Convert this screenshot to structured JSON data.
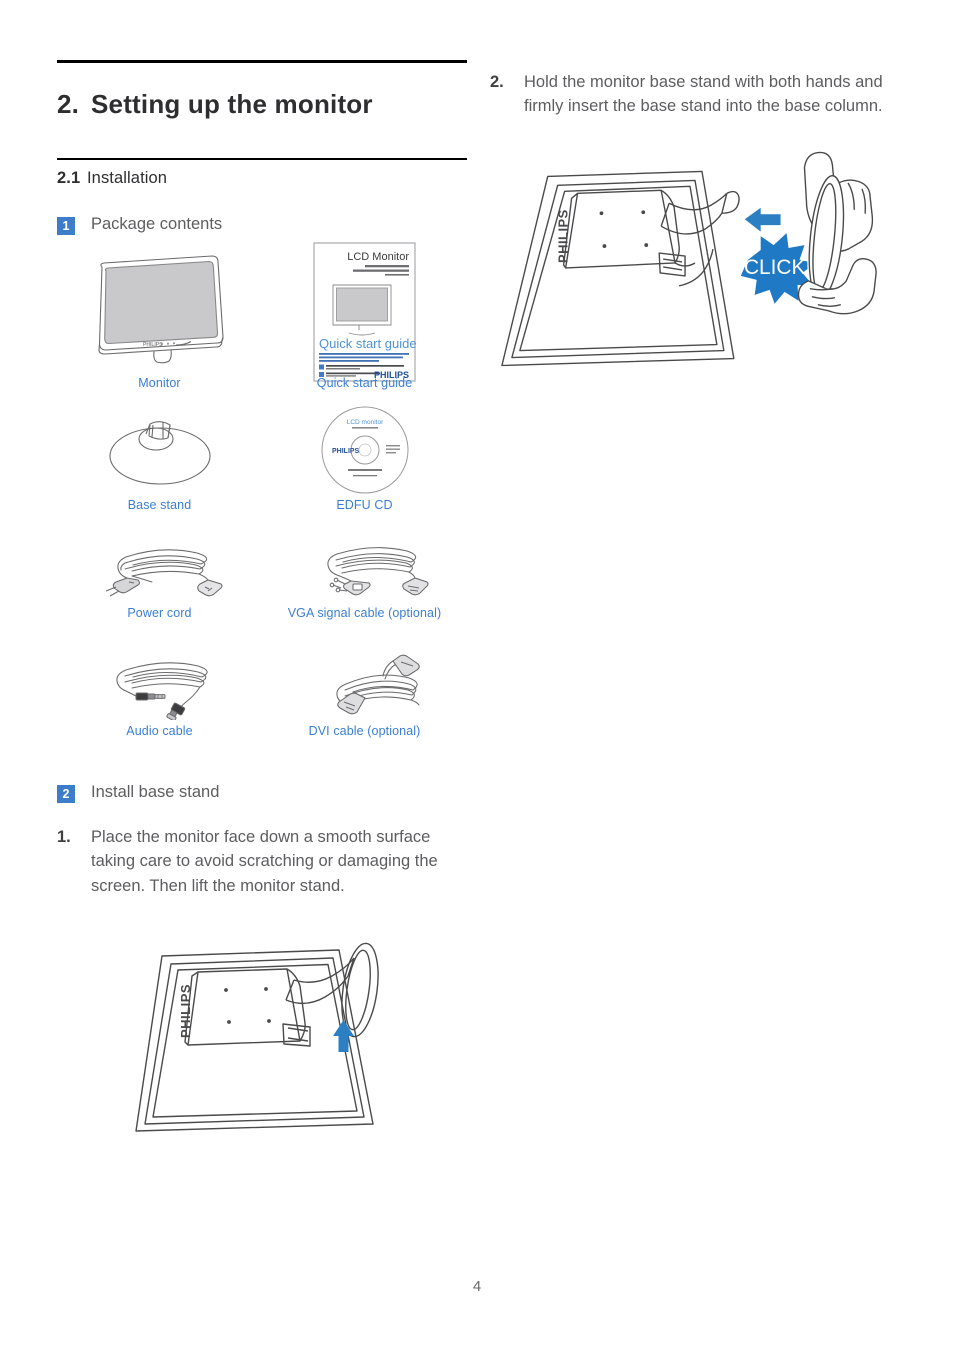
{
  "document": {
    "page_number": "4",
    "accent_blue": "#3b7fd4",
    "badge_blue": "#3d7cc9",
    "click_blue": "#1f79c4",
    "arrow_blue": "#2d7fc4"
  },
  "left_column": {
    "chapter": {
      "number": "2.",
      "title": "Setting up the monitor"
    },
    "section": {
      "number": "2.1",
      "label": "Installation"
    },
    "item1": {
      "badge": "1",
      "label": "Package contents"
    },
    "package_contents": [
      {
        "label": "Monitor",
        "art": "monitor-illustration"
      },
      {
        "label": "Quick start guide",
        "art": "quick-start-guide-illustration"
      },
      {
        "label": "Base stand",
        "art": "base-stand-illustration"
      },
      {
        "label": "EDFU CD",
        "art": "edfu-cd-illustration"
      },
      {
        "label": "Power cord",
        "art": "power-cord-illustration"
      },
      {
        "label": "VGA signal cable (optional)",
        "art": "vga-cable-illustration"
      },
      {
        "label": "Audio cable",
        "art": "audio-cable-illustration"
      },
      {
        "label": "DVI cable (optional)",
        "art": "dvi-cable-illustration"
      }
    ],
    "item2": {
      "badge": "2",
      "label": "Install base stand"
    },
    "step1": {
      "number": "1.",
      "text": "Place the monitor face down a smooth surface taking care to avoid scratching or damaging the screen. Then lift the monitor stand."
    },
    "figure1": {
      "name": "lift-monitor-stand-illustration",
      "brand_text": "PHILIPS"
    }
  },
  "right_column": {
    "step2": {
      "number": "2.",
      "text": "Hold the monitor base stand with both hands and firmly insert the base stand into the base column."
    },
    "figure2": {
      "name": "insert-base-stand-illustration",
      "brand_text": "PHILIPS",
      "click_label": "CLICK!"
    }
  },
  "quick_start_guide_thumb": {
    "heading": "LCD Monitor",
    "title": "Quick start guide",
    "brand": "PHILIPS"
  },
  "edfu_cd_thumb": {
    "line1": "LCD monitor",
    "brand": "PHILIPS"
  }
}
